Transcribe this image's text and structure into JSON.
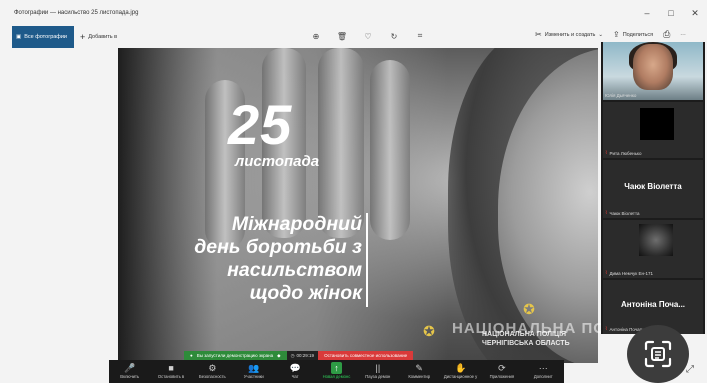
{
  "window": {
    "title": "Фотографии — насильство 25 листопада.jpg",
    "minimize": "–",
    "maximize": "□",
    "close": "✕"
  },
  "toolbar": {
    "all_photos": "Все фотографии",
    "add": "Добавить в",
    "edit_create": "Изменить и создать",
    "share": "Поделиться",
    "more": "···"
  },
  "poster": {
    "day": "25",
    "month": "листопада",
    "line1": "Міжнародний",
    "line2": "день боротьби з",
    "line3": "насильством",
    "line4": "щодо жінок",
    "police_watermark": "НАЦІОНАЛЬНА ПОЛІЦІЯ",
    "police_region1": "НАЦІОНАЛЬНА ПОЛІЦІЯ",
    "police_region2": "ЧЕРНІГІВСЬКА ОБЛАСТЬ"
  },
  "participants": [
    {
      "name": "Юлія Дьяченко"
    },
    {
      "name": "Рита Любенько"
    },
    {
      "big": "Чаюк Віолетта",
      "name": "Чаюк Віолетта"
    },
    {
      "name": "Дима Немчук Ен-171"
    },
    {
      "big": "Антоніна Поча...",
      "name": "Антоніна Почапська ЕН-171"
    }
  ],
  "share_bar": {
    "sharing_text": "Вы запустили демонстрацию экрана",
    "timer": "00:29:19",
    "stop_text": "Остановить совместное использование"
  },
  "zoom_controls": [
    {
      "icon": "🎤",
      "label": "Включить"
    },
    {
      "icon": "■",
      "label": "Остановить в"
    },
    {
      "icon": "⚙",
      "label": "Безопасность"
    },
    {
      "icon": "👥",
      "label": "Участники"
    },
    {
      "icon": "💬",
      "label": "Чат"
    },
    {
      "icon": "↑",
      "label": "Новая демонс"
    },
    {
      "icon": "||",
      "label": "Пауза демон"
    },
    {
      "icon": "✎",
      "label": "Комментир"
    },
    {
      "icon": "✋",
      "label": "Дистанционное у"
    },
    {
      "icon": "⟳",
      "label": "Приложения"
    },
    {
      "icon": "···",
      "label": "Дополнит"
    }
  ],
  "colors": {
    "zoom_green": "#2e8b3a",
    "zoom_red": "#d93a3a",
    "photos_accent": "#1e5a8a"
  }
}
